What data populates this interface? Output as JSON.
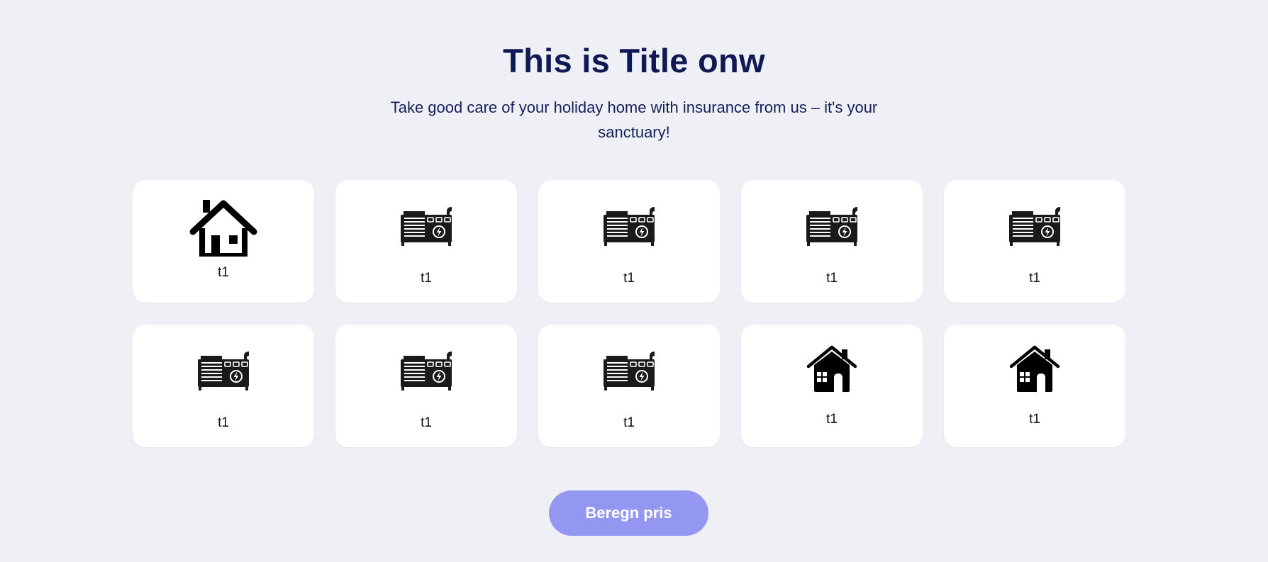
{
  "header": {
    "title": "This is Title onw",
    "subtitle": "Take good care of your holiday home with insurance from us – it's your sanctuary!"
  },
  "options": [
    {
      "label": "t1",
      "icon": "house-roof-icon"
    },
    {
      "label": "t1",
      "icon": "generator-icon"
    },
    {
      "label": "t1",
      "icon": "generator-icon"
    },
    {
      "label": "t1",
      "icon": "generator-icon"
    },
    {
      "label": "t1",
      "icon": "generator-icon"
    },
    {
      "label": "t1",
      "icon": "generator-icon"
    },
    {
      "label": "t1",
      "icon": "generator-icon"
    },
    {
      "label": "t1",
      "icon": "generator-icon"
    },
    {
      "label": "t1",
      "icon": "house-solid-icon"
    },
    {
      "label": "t1",
      "icon": "house-solid-icon"
    }
  ],
  "cta": {
    "label": "Beregn pris"
  },
  "colors": {
    "background": "#eff0f5",
    "title": "#0f1a55",
    "button": "#9497f2",
    "card": "#ffffff"
  }
}
